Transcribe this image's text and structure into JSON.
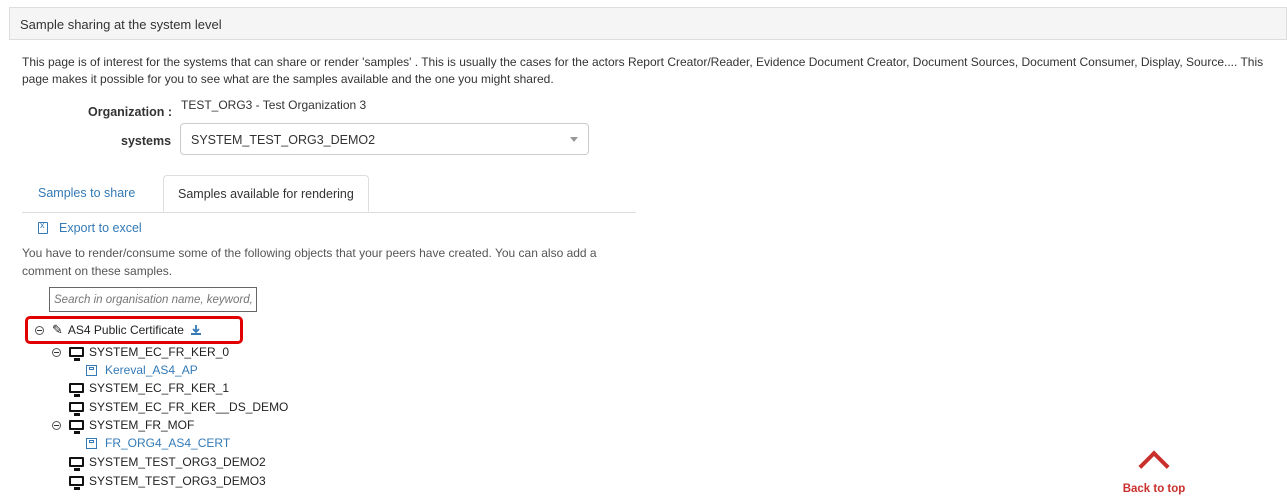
{
  "panel": {
    "title": "Sample sharing at the system level"
  },
  "intro": {
    "line1": "This page is of interest for the systems that can share or render 'samples' . This is usually the cases for the actors Report Creator/Reader, Evidence Document Creator, Document Sources, Document Consumer, Display, Source.... This",
    "line2": "page makes it possible for you to see what are the samples available and the one you might shared."
  },
  "form": {
    "organization_label": "Organization :",
    "organization_value": "TEST_ORG3 - Test Organization 3",
    "systems_label": "systems",
    "systems_value": "SYSTEM_TEST_ORG3_DEMO2"
  },
  "tabs": [
    {
      "label": "Samples to share",
      "active": false
    },
    {
      "label": "Samples available for rendering",
      "active": true
    }
  ],
  "export_label": "Export to excel",
  "description": "You have to render/consume some of the following objects that your peers have created. You can also add a comment on these samples.",
  "search": {
    "placeholder": "Search in organisation name, keyword, de"
  },
  "tree": {
    "root": "AS4 Public Certificate",
    "nodes": [
      "SYSTEM_EC_FR_KER_0",
      "Kereval_AS4_AP",
      "SYSTEM_EC_FR_KER_1",
      "SYSTEM_EC_FR_KER__DS_DEMO",
      "SYSTEM_FR_MOF",
      "FR_ORG4_AS4_CERT",
      "SYSTEM_TEST_ORG3_DEMO2",
      "SYSTEM_TEST_ORG3_DEMO3"
    ]
  },
  "back_to_top": "Back to top",
  "colors": {
    "link": "#337ab7",
    "highlight": "#e00000",
    "back_to_top": "#c9302c"
  }
}
